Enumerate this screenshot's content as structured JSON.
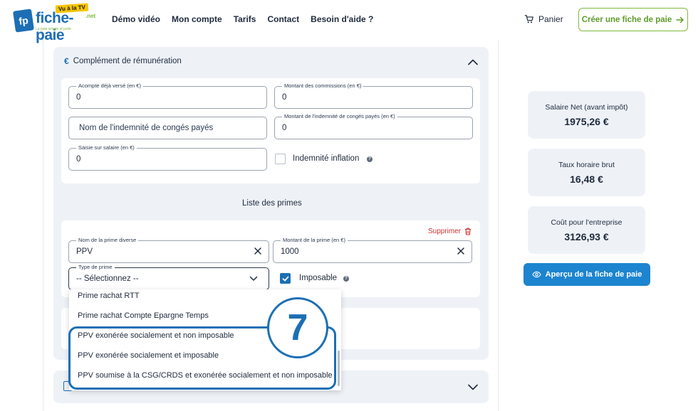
{
  "header": {
    "logo_badge": "fp",
    "logo_text": "fiche-paie",
    "logo_tv": "Vu à la TV",
    "logo_net": ".net",
    "logo_tagline": "La paie simple et juste",
    "nav": [
      "Démo vidéo",
      "Mon compte",
      "Tarifs",
      "Contact",
      "Besoin d'aide ?"
    ],
    "cart_label": "Panier",
    "cta_label": "Créer une fiche de paie"
  },
  "section": {
    "title": "Complément de rémunération",
    "fields": {
      "acompte": {
        "label": "Acompte déjà versé (en €)",
        "value": "0"
      },
      "commissions": {
        "label": "Montant des commissions (en €)",
        "value": "0"
      },
      "indemnite_nom": {
        "placeholder": "Nom de l'indemnité de congés payés"
      },
      "indemnite_montant": {
        "label": "Montant de l'indemnité de congés payés (en €)",
        "value": "0"
      },
      "saisie": {
        "label": "Saisie sur salaire (en €)",
        "value": "0"
      }
    },
    "inflation_label": "Indemnité inflation",
    "inflation_checked": false
  },
  "primes": {
    "list_title": "Liste des primes",
    "delete_label": "Supprimer",
    "nom": {
      "label": "Nom de la prime diverse",
      "value": "PPV"
    },
    "montant": {
      "label": "Montant de la prime (en €)",
      "value": "1000"
    },
    "type": {
      "label": "Type de prime",
      "value": "-- Sélectionnez --"
    },
    "imposable_label": "Imposable",
    "imposable_checked": true,
    "options": [
      "Prime rachat RTT",
      "Prime rachat Compte Epargne Temps",
      "PPV exonérée socialement et non imposable",
      "PPV exonérée socialement et imposable",
      "PPV soumise à la CSG/CRDS et exonérée socialement et non imposable"
    ]
  },
  "step_number": "7",
  "summary": {
    "net_label": "Salaire Net (avant impôt)",
    "net_value": "1975,26 €",
    "taux_label": "Taux horaire brut",
    "taux_value": "16,48 €",
    "cout_label": "Coût pour l'entreprise",
    "cout_value": "3126,93 €",
    "preview_label": "Aperçu de la fiche de paie"
  },
  "colors": {
    "brand_blue": "#1c6fb5",
    "brand_green": "#7dbb3c",
    "danger": "#d32f2f"
  }
}
